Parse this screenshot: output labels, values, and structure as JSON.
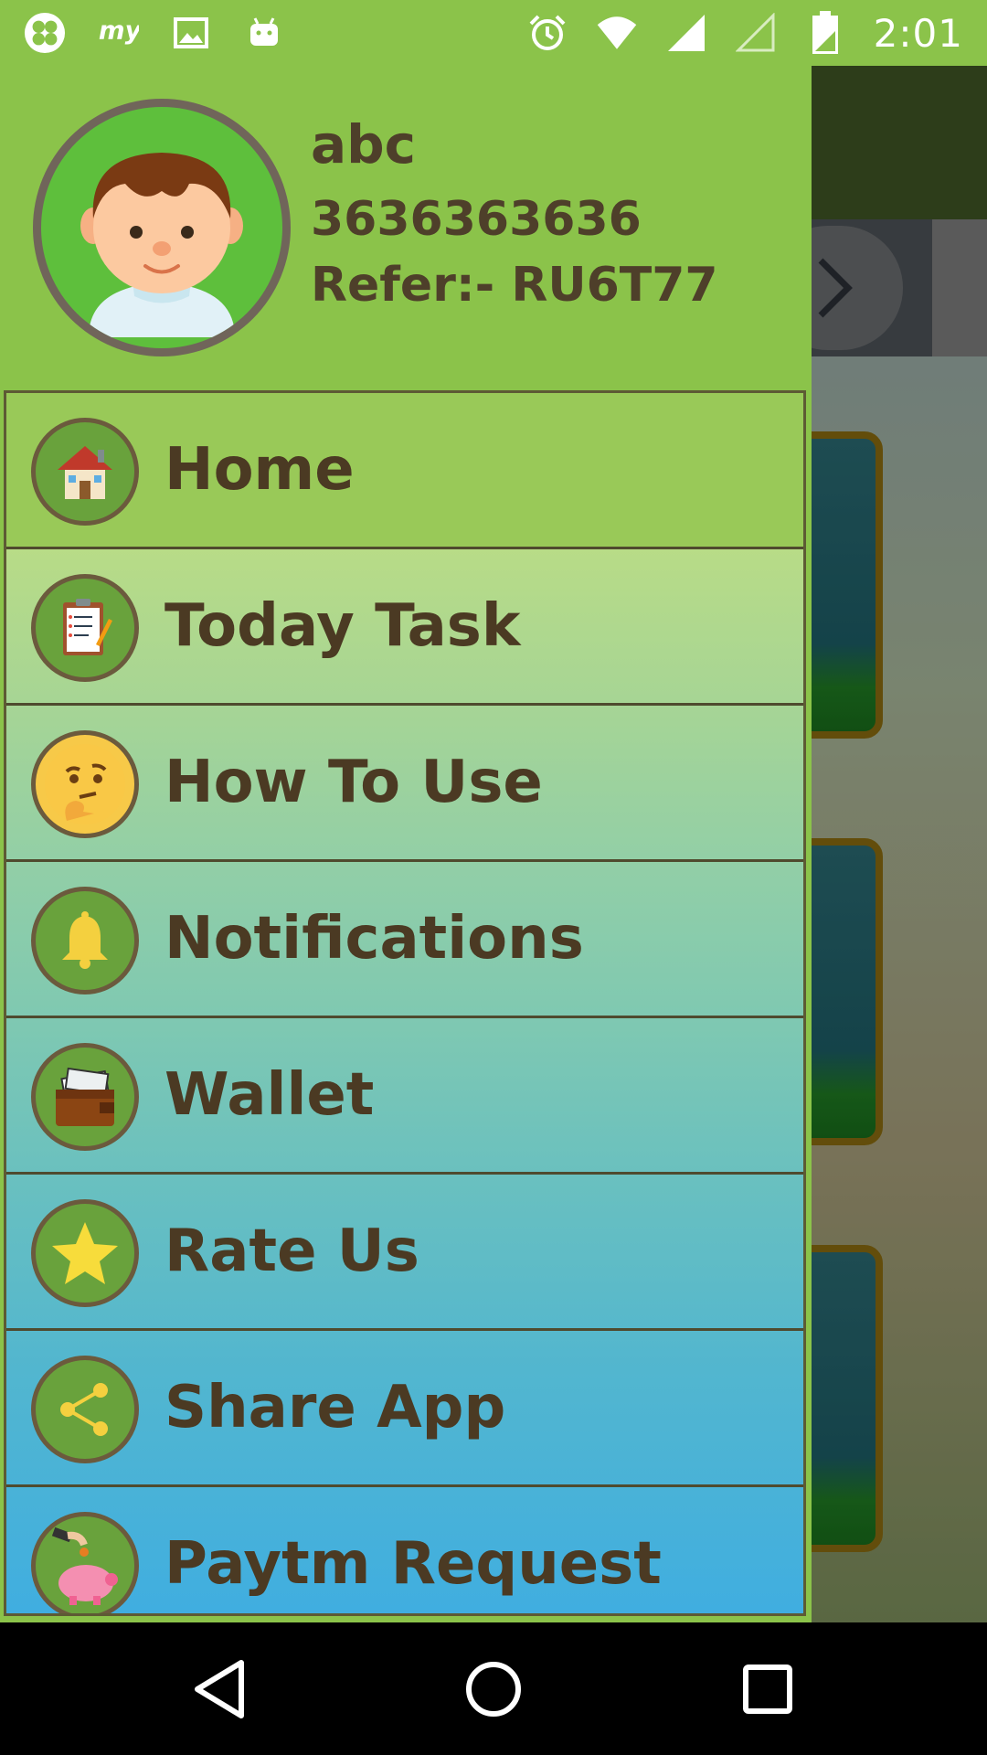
{
  "status_bar": {
    "time": "2:01",
    "left_icons": [
      "clover-app-icon",
      "myntra-app-icon",
      "image-icon",
      "android-icon"
    ],
    "right_icons": [
      "alarm-icon",
      "wifi-icon",
      "signal-icon",
      "signal-empty-icon",
      "battery-icon"
    ]
  },
  "profile": {
    "name": "abc",
    "phone": "3636363636",
    "refer": "Refer:- RU6T77",
    "avatar": "boy-avatar"
  },
  "menu": {
    "items": [
      {
        "label": "Home",
        "icon": "house-icon"
      },
      {
        "label": "Today Task",
        "icon": "clipboard-icon"
      },
      {
        "label": "How To Use",
        "icon": "thinking-face-icon"
      },
      {
        "label": "Notifications",
        "icon": "bell-icon"
      },
      {
        "label": "Wallet",
        "icon": "wallet-icon"
      },
      {
        "label": "Rate Us",
        "icon": "star-icon"
      },
      {
        "label": "Share App",
        "icon": "share-icon"
      },
      {
        "label": "Paytm Request",
        "icon": "piggy-bank-icon"
      }
    ]
  },
  "nav_bar": {
    "buttons": [
      "back-icon",
      "home-icon",
      "recents-icon"
    ]
  },
  "colors": {
    "drawer_header": "#8bc34a",
    "text_brown": "#4b3a23",
    "icon_ring": "#6b5a3d"
  }
}
